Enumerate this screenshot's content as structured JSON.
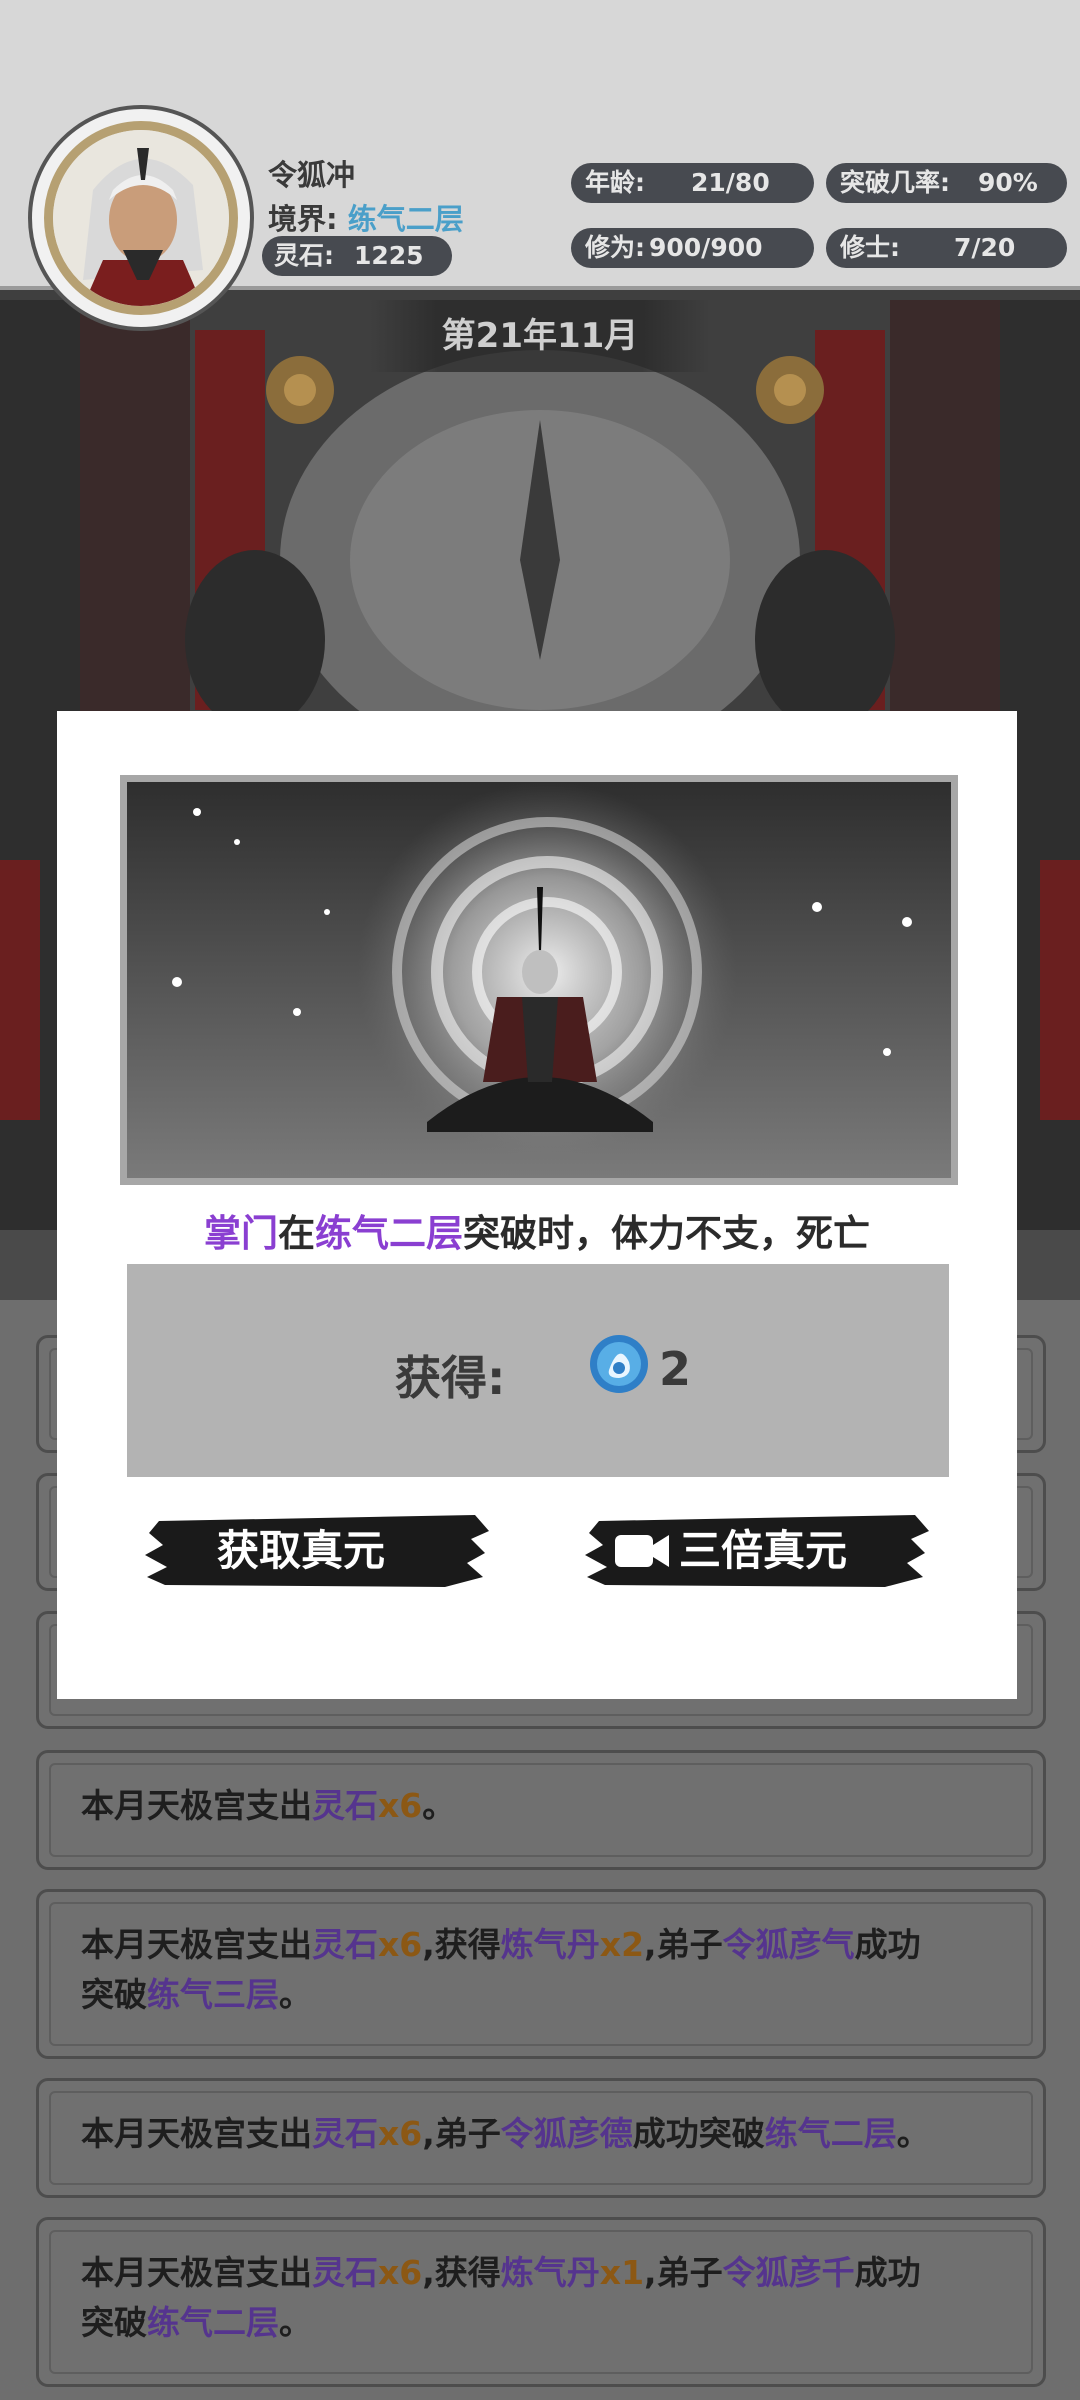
{
  "player": {
    "name": "令狐冲",
    "realm_label": "境界:",
    "realm_value": "练气二层",
    "spirit_stone_label": "灵石:",
    "spirit_stone_value": "1225"
  },
  "stats": {
    "age_label": "年龄:",
    "age_value": "21/80",
    "breakthrough_label": "突破几率:",
    "breakthrough_value": "90%",
    "cultivation_label": "修为:",
    "cultivation_value": "900/900",
    "cultivators_label": "修士:",
    "cultivators_value": "7/20"
  },
  "date_banner": "第21年11月",
  "modal": {
    "result_parts": [
      "掌门",
      "在",
      "练气二层",
      "突破时，体力不支，死亡"
    ],
    "reward_label": "获得:",
    "reward_icon": "true-essence-orb-icon",
    "reward_count": "2",
    "get_button_label": "获取真元",
    "triple_button_label": "三倍真元",
    "triple_button_icon": "video-camera-icon"
  },
  "log": {
    "entry1": [
      "本月天极宫支出",
      "灵石",
      "x6",
      "。"
    ],
    "entry2_line1": [
      "本月天极宫支出",
      "灵石",
      "x6",
      ",获得",
      "炼气丹",
      "x2",
      ",弟子",
      "令狐彦气",
      "成功"
    ],
    "entry2_line2": [
      "突破",
      "练气三层",
      "。"
    ],
    "entry3": [
      "本月天极宫支出",
      "灵石",
      "x6",
      ",弟子",
      "令狐彦德",
      "成功突破",
      "练气二层",
      "。"
    ],
    "entry4_line1": [
      "本月天极宫支出",
      "灵石",
      "x6",
      ",获得",
      "炼气丹",
      "x1",
      ",弟子",
      "令狐彦千",
      "成功"
    ],
    "entry4_line2": [
      "突破",
      "练气二层",
      "。"
    ]
  },
  "colors": {
    "realm_accent": "#4a9fc9",
    "highlight_purple": "#8a3fd1",
    "log_purple": "#55348e",
    "log_orange": "#8c5814",
    "pill_bg": "#474a50"
  }
}
